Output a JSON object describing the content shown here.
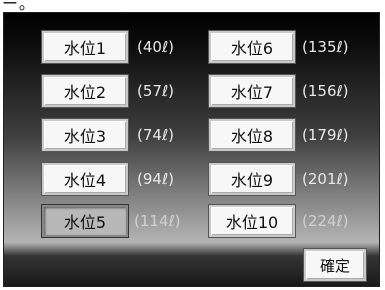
{
  "header": {
    "text": "ー。"
  },
  "levels": [
    {
      "label": "水位1",
      "volume": "(40ℓ)"
    },
    {
      "label": "水位2",
      "volume": "(57ℓ)"
    },
    {
      "label": "水位3",
      "volume": "(74ℓ)"
    },
    {
      "label": "水位4",
      "volume": "(94ℓ)"
    },
    {
      "label": "水位5",
      "volume": "(114ℓ)",
      "selected": true
    },
    {
      "label": "水位6",
      "volume": "(135ℓ)"
    },
    {
      "label": "水位7",
      "volume": "(156ℓ)"
    },
    {
      "label": "水位8",
      "volume": "(179ℓ)"
    },
    {
      "label": "水位9",
      "volume": "(201ℓ)"
    },
    {
      "label": "水位10",
      "volume": "(224ℓ)"
    }
  ],
  "confirm_label": "確定"
}
